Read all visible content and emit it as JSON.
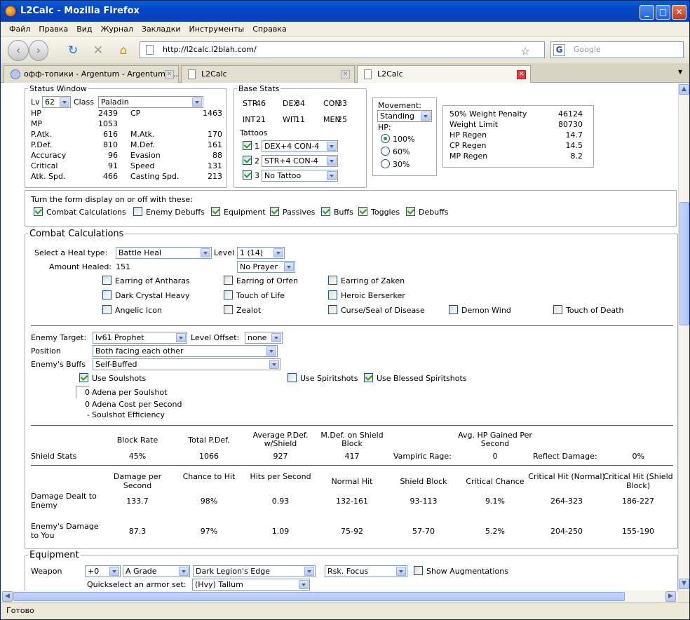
{
  "window": {
    "title": "L2Calc - Mozilla Firefox"
  },
  "menu": [
    "Файл",
    "Правка",
    "Вид",
    "Журнал",
    "Закладки",
    "Инструменты",
    "Справка"
  ],
  "nav": {
    "url": "http://l2calc.l2blah.com/",
    "search_placeholder": "Google"
  },
  "tabs": [
    {
      "label": "офф-топики - Argentum - Argentum - ..."
    },
    {
      "label": "L2Calc"
    },
    {
      "label": "L2Calc"
    }
  ],
  "status": "Готово",
  "status_window": {
    "legend": "Status Window",
    "lv_label": "Lv",
    "lv": "62",
    "class_label": "Class",
    "class": "Paladin",
    "left": [
      [
        "HP",
        "2439"
      ],
      [
        "MP",
        "1053"
      ],
      [
        "P.Atk.",
        "616"
      ],
      [
        "P.Def.",
        "810"
      ],
      [
        "Accuracy",
        "96"
      ],
      [
        "Critical",
        "91"
      ],
      [
        "Atk. Spd.",
        "466"
      ]
    ],
    "right": [
      [
        "CP",
        "1463"
      ],
      [
        "M.Atk.",
        "170"
      ],
      [
        "M.Def.",
        "161"
      ],
      [
        "Evasion",
        "88"
      ],
      [
        "Speed",
        "131"
      ],
      [
        "Casting Spd.",
        "213"
      ]
    ]
  },
  "base_stats": {
    "legend": "Base Stats",
    "row1": [
      [
        "STR",
        "46"
      ],
      [
        "DEX",
        "34"
      ],
      [
        "CON",
        "33"
      ]
    ],
    "row2": [
      [
        "INT",
        "21"
      ],
      [
        "WIT",
        "11"
      ],
      [
        "MEN",
        "25"
      ]
    ],
    "tattoos_label": "Tattoos",
    "tattoos": [
      {
        "n": "1",
        "v": "DEX+4 CON-4"
      },
      {
        "n": "2",
        "v": "STR+4 CON-4"
      },
      {
        "n": "3",
        "v": "No Tattoo"
      }
    ]
  },
  "movement": {
    "label": "Movement:",
    "value": "Standing",
    "hp_label": "HP:",
    "options": [
      "100%",
      "60%",
      "30%"
    ]
  },
  "weight": [
    [
      "50% Weight Penalty",
      "46124"
    ],
    [
      "Weight Limit",
      "80730"
    ],
    [
      "HP Regen",
      "14.7"
    ],
    [
      "CP Regen",
      "14.5"
    ],
    [
      "MP Regen",
      "8.2"
    ]
  ],
  "toggles": {
    "intro": "Turn the form display on or off with these:",
    "items": [
      {
        "l": "Combat Calculations",
        "on": true
      },
      {
        "l": "Enemy Debuffs",
        "on": false
      },
      {
        "l": "Equipment",
        "on": true
      },
      {
        "l": "Passives",
        "on": true
      },
      {
        "l": "Buffs",
        "on": true
      },
      {
        "l": "Toggles",
        "on": true
      },
      {
        "l": "Debuffs",
        "on": true
      }
    ]
  },
  "combat": {
    "legend": "Combat Calculations",
    "heal_label": "Select a Heal type:",
    "heal": "Battle Heal",
    "level_label": "Level",
    "level": "1 (14)",
    "amount_label": "Amount Healed:",
    "amount": "151",
    "prayer": "No Prayer",
    "checks": [
      "Earring of Antharas",
      "Earring of Orfen",
      "Earring of Zaken",
      "Dark Crystal Heavy",
      "Touch of Life",
      "Heroic Berserker",
      "Angelic Icon",
      "Zealot",
      "Curse/Seal of Disease",
      "Demon Wind",
      "Touch of Death"
    ],
    "enemy_target_label": "Enemy Target:",
    "enemy_target": "lv61 Prophet",
    "level_offset_label": "Level Offset:",
    "level_offset": "none",
    "position_label": "Position",
    "position": "Both facing each other",
    "buffs_label": "Enemy's Buffs",
    "buffs": "Self-Buffed",
    "use_soulshots": "Use Soulshots",
    "use_spiritshots": "Use Spiritshots",
    "use_blessed": "Use Blessed Spiritshots",
    "adena_ss_value": "0",
    "adena_ss_label": "Adena per Soulshot",
    "adena_cost": "0",
    "adena_cost_label": "Adena Cost per Second",
    "ss_eff": "-",
    "ss_eff_label": "Soulshot Efficiency"
  },
  "shield": {
    "headers": [
      "Block Rate",
      "Total P.Def.",
      "Average P.Def. w/Shield",
      "M.Def. on Shield Block",
      "Avg. HP Gained Per Second"
    ],
    "row_label": "Shield Stats",
    "values": [
      "45%",
      "1066",
      "927",
      "417"
    ],
    "vampiric_label": "Vampiric Rage:",
    "vampiric": "0",
    "reflect_label": "Reflect Damage:",
    "reflect": "0%"
  },
  "damage": {
    "headers": [
      "Damage per Second",
      "Chance to Hit",
      "Hits per Second",
      "Normal Hit",
      "Shield Block",
      "Critical Chance",
      "Critical Hit (Normal)",
      "Critical Hit (Shield Block)"
    ],
    "rows": [
      {
        "label": "Damage Dealt to Enemy",
        "values": [
          "133.7",
          "98%",
          "0.93",
          "132-161",
          "93-113",
          "9.1%",
          "264-323",
          "186-227"
        ]
      },
      {
        "label": "Enemy's Damage to You",
        "values": [
          "87.3",
          "97%",
          "1.09",
          "75-92",
          "57-70",
          "5.2%",
          "204-250",
          "155-190"
        ]
      }
    ]
  },
  "equipment": {
    "legend": "Equipment",
    "weapon_label": "Weapon",
    "enchant": "+0",
    "grade": "A Grade",
    "weapon": "Dark Legion's Edge",
    "sa": "Rsk. Focus",
    "show_aug": "Show Augmentations",
    "armor_label": "Quickselect an armor set:",
    "armor": "(Hvy) Tallum"
  }
}
